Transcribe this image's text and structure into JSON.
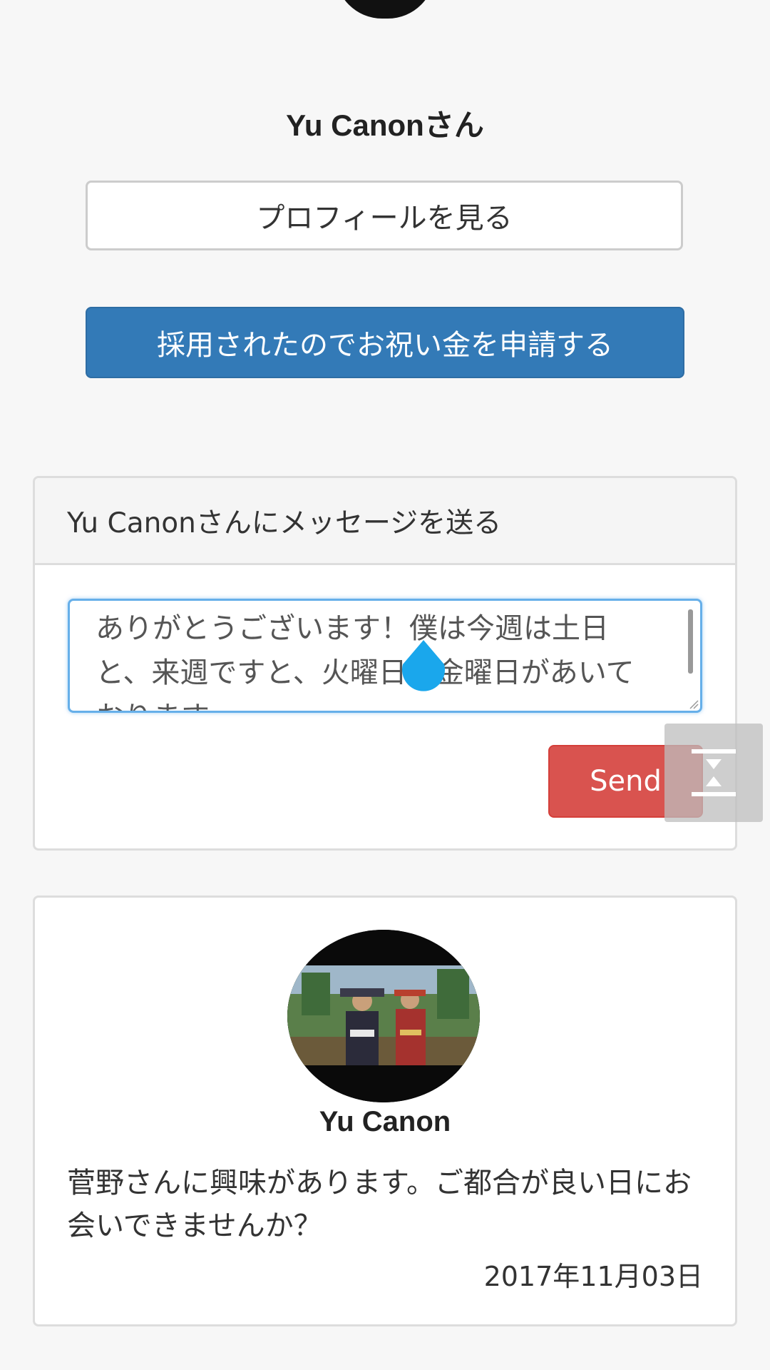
{
  "header": {
    "user_name": "Yu Canonさん"
  },
  "actions": {
    "view_profile_label": "プロフィールを見る",
    "apply_bonus_label": "採用されたのでお祝い金を申請する"
  },
  "message_panel": {
    "title": "Yu Canonさんにメッセージを送る",
    "textarea_value": "ありがとうございます！僕は今週は土日と、来週ですと、火曜日と金曜日があいております。",
    "send_label": "Send"
  },
  "message_card": {
    "sender_name": "Yu Canon",
    "body": "菅野さんに興味があります。ご都合が良い日にお会いできませんか？",
    "date": "2017年11月03日"
  },
  "colors": {
    "primary": "#337ab7",
    "danger": "#d9534f",
    "focus": "#66afe9",
    "cursor_handle": "#1aa7ec"
  }
}
